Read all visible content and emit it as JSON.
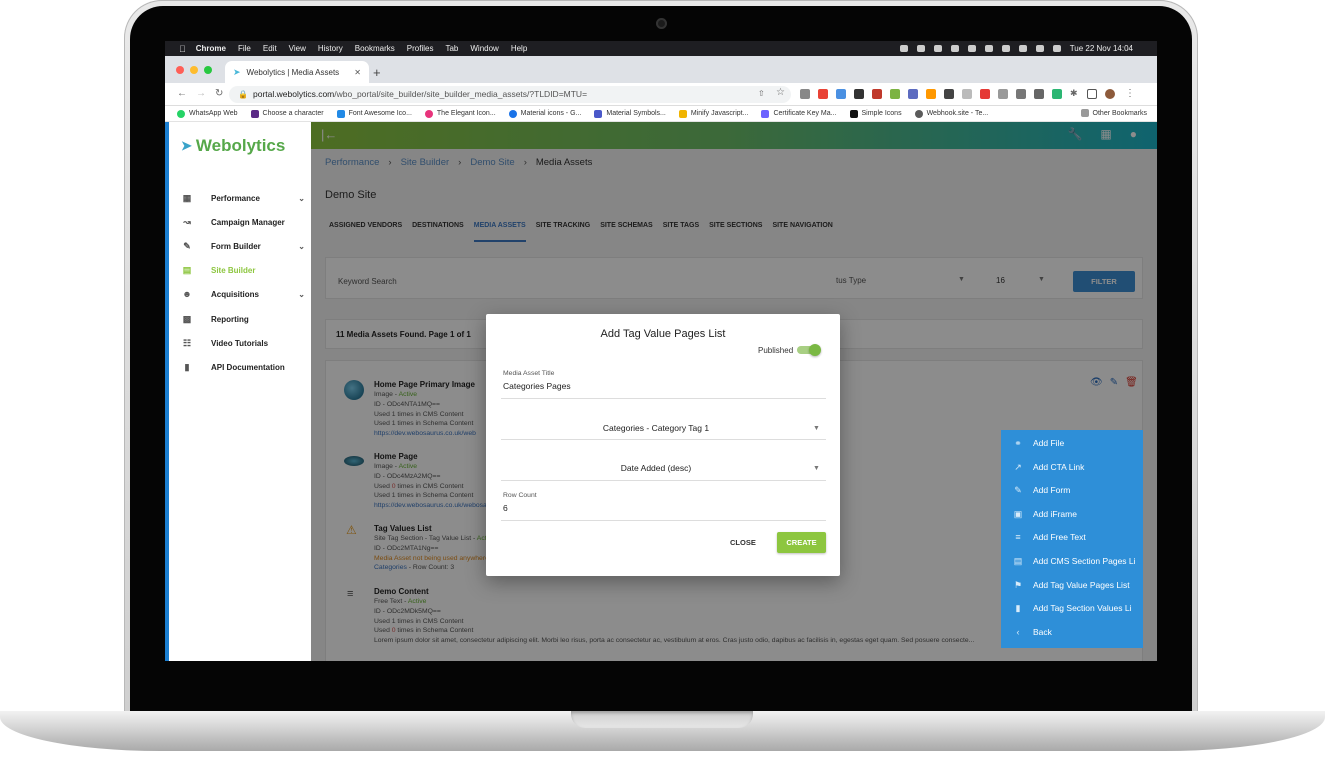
{
  "menubar": {
    "app_name": "Chrome",
    "menus": [
      "File",
      "Edit",
      "View",
      "History",
      "Bookmarks",
      "Profiles",
      "Tab",
      "Window",
      "Help"
    ],
    "clock": "Tue 22 Nov  14:04"
  },
  "browser": {
    "tab_title": "Webolytics | Media Assets",
    "url_host": "portal.webolytics.com",
    "url_path": "/wbo_portal/site_builder/site_builder_media_assets/?TLDID=MTU=",
    "bookmarks": [
      {
        "label": "WhatsApp Web",
        "color": "#25d366"
      },
      {
        "label": "Choose a character",
        "color": "#5b2a86"
      },
      {
        "label": "Font Awesome Ico...",
        "color": "#228ae6"
      },
      {
        "label": "The Elegant Icon...",
        "color": "#e8347c"
      },
      {
        "label": "Material icons - G...",
        "color": "#1a73e8"
      },
      {
        "label": "Material Symbols...",
        "color": "#4a58c9"
      },
      {
        "label": "Minify Javascript...",
        "color": "#f0b400"
      },
      {
        "label": "Certificate Key Ma...",
        "color": "#6c63ff"
      },
      {
        "label": "Simple Icons",
        "color": "#111111"
      },
      {
        "label": "Webhook.site - Te...",
        "color": "#5b5b5b"
      }
    ],
    "other_bookmarks": "Other Bookmarks"
  },
  "sidebar": {
    "logo_text": "Webolytics",
    "items": [
      {
        "label": "Performance",
        "icon": "chart-icon",
        "has_children": true,
        "active": false
      },
      {
        "label": "Campaign Manager",
        "icon": "trend-icon",
        "has_children": false,
        "active": false
      },
      {
        "label": "Form Builder",
        "icon": "form-icon",
        "has_children": true,
        "active": false
      },
      {
        "label": "Site Builder",
        "icon": "site-icon",
        "has_children": false,
        "active": true
      },
      {
        "label": "Acquisitions",
        "icon": "people-icon",
        "has_children": true,
        "active": false
      },
      {
        "label": "Reporting",
        "icon": "report-icon",
        "has_children": false,
        "active": false
      },
      {
        "label": "Video Tutorials",
        "icon": "video-icon",
        "has_children": false,
        "active": false
      },
      {
        "label": "API Documentation",
        "icon": "book-icon",
        "has_children": false,
        "active": false
      }
    ]
  },
  "breadcrumb": {
    "items": [
      "Performance",
      "Site Builder",
      "Demo Site"
    ],
    "current": "Media Assets"
  },
  "page": {
    "title": "Demo Site",
    "tabs": [
      "ASSIGNED VENDORS",
      "DESTINATIONS",
      "MEDIA ASSETS",
      "SITE TRACKING",
      "SITE SCHEMAS",
      "SITE TAGS",
      "SITE SECTIONS",
      "SITE NAVIGATION"
    ],
    "active_tab": "MEDIA ASSETS"
  },
  "filters": {
    "keyword_placeholder": "Keyword Search",
    "status_type": "tus Type",
    "per_page": "16",
    "filter_label": "FILTER"
  },
  "results_summary": "11 Media Assets Found. Page 1 of 1",
  "assets": [
    {
      "title": "Home Page Primary Image",
      "type": "Image",
      "status": "Active",
      "id": "ID - ODc4NTA1MQ==",
      "cms": "Used 1 times in CMS Content",
      "schema": "Used 1 times in Schema Content",
      "link": "https://dev.webosaurus.co.uk/web"
    },
    {
      "title": "Home Page",
      "type": "Image",
      "status": "Active",
      "id": "ID - ODc4MzA2MQ==",
      "cms_prefix": "Used ",
      "cms_count": "0",
      "cms_suffix": " times in CMS Content",
      "schema": "Used 1 times in Schema Content",
      "link": "https://dev.webosaurus.co.uk/webosaurus/demo-site/images/hp-1023x512-jpg.jpg"
    },
    {
      "title": "Tag Values List",
      "type": "Site Tag Section - Tag Value List",
      "status": "Active",
      "id": "ID - ODc2MTA1Ng==",
      "warning": "Media Asset not being used anywhere on site currently.",
      "category_link": "Categories",
      "row_count": " - Row Count: 3"
    },
    {
      "title": "Demo Content",
      "type": "Free Text",
      "status": "Active",
      "id": "ID - ODc2MDk5MQ==",
      "cms": "Used 1 times in CMS Content",
      "schema_prefix": "Used ",
      "schema_count": "0",
      "schema_suffix": " times in Schema Content",
      "excerpt": "Lorem ipsum dolor sit amet, consectetur adipiscing elit. Morbi leo risus, porta ac consectetur ac, vestibulum at eros. Cras justo odio, dapibus ac facilisis in, egestas eget quam. Sed posuere consecte..."
    }
  ],
  "modal": {
    "title": "Add Tag Value Pages List",
    "published_label": "Published",
    "published": true,
    "media_title_label": "Media Asset Title",
    "media_title_value": "Categories Pages",
    "tag_select": "Categories - Category Tag 1",
    "sort_select": "Date Added (desc)",
    "row_count_label": "Row Count",
    "row_count_value": "6",
    "close_label": "CLOSE",
    "create_label": "CREATE"
  },
  "speed_dial": [
    {
      "label": "Add File",
      "icon": "link-icon"
    },
    {
      "label": "Add CTA Link",
      "icon": "external-link-icon"
    },
    {
      "label": "Add Form",
      "icon": "form-icon"
    },
    {
      "label": "Add iFrame",
      "icon": "iframe-icon"
    },
    {
      "label": "Add Free Text",
      "icon": "text-icon"
    },
    {
      "label": "Add CMS Section Pages Li",
      "icon": "section-icon"
    },
    {
      "label": "Add Tag Value Pages List",
      "icon": "tag-icon"
    },
    {
      "label": "Add Tag Section Values Li",
      "icon": "label-icon"
    },
    {
      "label": "Back",
      "icon": "chevron-left-icon"
    }
  ],
  "colors": {
    "brand_green": "#8dc63f",
    "brand_blue": "#2e8fd8",
    "link_blue": "#3a73c0"
  }
}
